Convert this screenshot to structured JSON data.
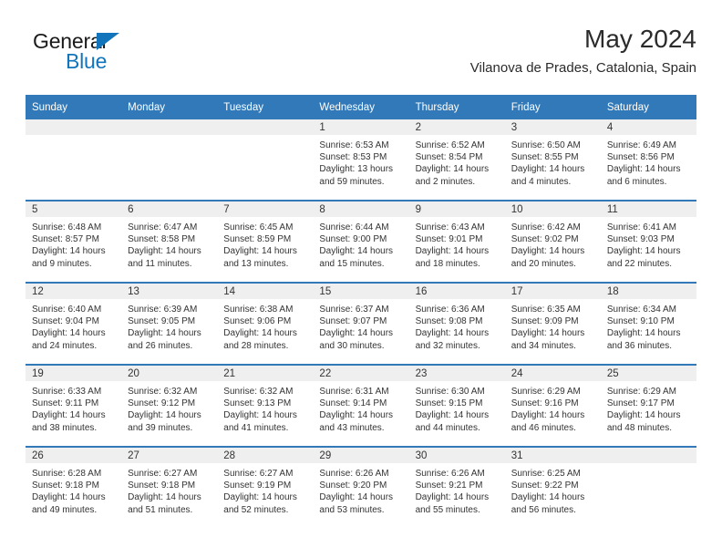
{
  "brand": {
    "name_part1": "General",
    "name_part2": "Blue",
    "triangle_color": "#1275bc"
  },
  "header": {
    "month_title": "May 2024",
    "location": "Vilanova de Prades, Catalonia, Spain"
  },
  "theme": {
    "header_blue": "#3179b8",
    "daynum_band": "#efefef",
    "text": "#333333"
  },
  "calendar": {
    "weekday_headers": [
      "Sunday",
      "Monday",
      "Tuesday",
      "Wednesday",
      "Thursday",
      "Friday",
      "Saturday"
    ],
    "weeks": [
      [
        {
          "day": "",
          "empty": true
        },
        {
          "day": "",
          "empty": true
        },
        {
          "day": "",
          "empty": true
        },
        {
          "day": "1",
          "sunrise": "Sunrise: 6:53 AM",
          "sunset": "Sunset: 8:53 PM",
          "daylight": "Daylight: 13 hours and 59 minutes."
        },
        {
          "day": "2",
          "sunrise": "Sunrise: 6:52 AM",
          "sunset": "Sunset: 8:54 PM",
          "daylight": "Daylight: 14 hours and 2 minutes."
        },
        {
          "day": "3",
          "sunrise": "Sunrise: 6:50 AM",
          "sunset": "Sunset: 8:55 PM",
          "daylight": "Daylight: 14 hours and 4 minutes."
        },
        {
          "day": "4",
          "sunrise": "Sunrise: 6:49 AM",
          "sunset": "Sunset: 8:56 PM",
          "daylight": "Daylight: 14 hours and 6 minutes."
        }
      ],
      [
        {
          "day": "5",
          "sunrise": "Sunrise: 6:48 AM",
          "sunset": "Sunset: 8:57 PM",
          "daylight": "Daylight: 14 hours and 9 minutes."
        },
        {
          "day": "6",
          "sunrise": "Sunrise: 6:47 AM",
          "sunset": "Sunset: 8:58 PM",
          "daylight": "Daylight: 14 hours and 11 minutes."
        },
        {
          "day": "7",
          "sunrise": "Sunrise: 6:45 AM",
          "sunset": "Sunset: 8:59 PM",
          "daylight": "Daylight: 14 hours and 13 minutes."
        },
        {
          "day": "8",
          "sunrise": "Sunrise: 6:44 AM",
          "sunset": "Sunset: 9:00 PM",
          "daylight": "Daylight: 14 hours and 15 minutes."
        },
        {
          "day": "9",
          "sunrise": "Sunrise: 6:43 AM",
          "sunset": "Sunset: 9:01 PM",
          "daylight": "Daylight: 14 hours and 18 minutes."
        },
        {
          "day": "10",
          "sunrise": "Sunrise: 6:42 AM",
          "sunset": "Sunset: 9:02 PM",
          "daylight": "Daylight: 14 hours and 20 minutes."
        },
        {
          "day": "11",
          "sunrise": "Sunrise: 6:41 AM",
          "sunset": "Sunset: 9:03 PM",
          "daylight": "Daylight: 14 hours and 22 minutes."
        }
      ],
      [
        {
          "day": "12",
          "sunrise": "Sunrise: 6:40 AM",
          "sunset": "Sunset: 9:04 PM",
          "daylight": "Daylight: 14 hours and 24 minutes."
        },
        {
          "day": "13",
          "sunrise": "Sunrise: 6:39 AM",
          "sunset": "Sunset: 9:05 PM",
          "daylight": "Daylight: 14 hours and 26 minutes."
        },
        {
          "day": "14",
          "sunrise": "Sunrise: 6:38 AM",
          "sunset": "Sunset: 9:06 PM",
          "daylight": "Daylight: 14 hours and 28 minutes."
        },
        {
          "day": "15",
          "sunrise": "Sunrise: 6:37 AM",
          "sunset": "Sunset: 9:07 PM",
          "daylight": "Daylight: 14 hours and 30 minutes."
        },
        {
          "day": "16",
          "sunrise": "Sunrise: 6:36 AM",
          "sunset": "Sunset: 9:08 PM",
          "daylight": "Daylight: 14 hours and 32 minutes."
        },
        {
          "day": "17",
          "sunrise": "Sunrise: 6:35 AM",
          "sunset": "Sunset: 9:09 PM",
          "daylight": "Daylight: 14 hours and 34 minutes."
        },
        {
          "day": "18",
          "sunrise": "Sunrise: 6:34 AM",
          "sunset": "Sunset: 9:10 PM",
          "daylight": "Daylight: 14 hours and 36 minutes."
        }
      ],
      [
        {
          "day": "19",
          "sunrise": "Sunrise: 6:33 AM",
          "sunset": "Sunset: 9:11 PM",
          "daylight": "Daylight: 14 hours and 38 minutes."
        },
        {
          "day": "20",
          "sunrise": "Sunrise: 6:32 AM",
          "sunset": "Sunset: 9:12 PM",
          "daylight": "Daylight: 14 hours and 39 minutes."
        },
        {
          "day": "21",
          "sunrise": "Sunrise: 6:32 AM",
          "sunset": "Sunset: 9:13 PM",
          "daylight": "Daylight: 14 hours and 41 minutes."
        },
        {
          "day": "22",
          "sunrise": "Sunrise: 6:31 AM",
          "sunset": "Sunset: 9:14 PM",
          "daylight": "Daylight: 14 hours and 43 minutes."
        },
        {
          "day": "23",
          "sunrise": "Sunrise: 6:30 AM",
          "sunset": "Sunset: 9:15 PM",
          "daylight": "Daylight: 14 hours and 44 minutes."
        },
        {
          "day": "24",
          "sunrise": "Sunrise: 6:29 AM",
          "sunset": "Sunset: 9:16 PM",
          "daylight": "Daylight: 14 hours and 46 minutes."
        },
        {
          "day": "25",
          "sunrise": "Sunrise: 6:29 AM",
          "sunset": "Sunset: 9:17 PM",
          "daylight": "Daylight: 14 hours and 48 minutes."
        }
      ],
      [
        {
          "day": "26",
          "sunrise": "Sunrise: 6:28 AM",
          "sunset": "Sunset: 9:18 PM",
          "daylight": "Daylight: 14 hours and 49 minutes."
        },
        {
          "day": "27",
          "sunrise": "Sunrise: 6:27 AM",
          "sunset": "Sunset: 9:18 PM",
          "daylight": "Daylight: 14 hours and 51 minutes."
        },
        {
          "day": "28",
          "sunrise": "Sunrise: 6:27 AM",
          "sunset": "Sunset: 9:19 PM",
          "daylight": "Daylight: 14 hours and 52 minutes."
        },
        {
          "day": "29",
          "sunrise": "Sunrise: 6:26 AM",
          "sunset": "Sunset: 9:20 PM",
          "daylight": "Daylight: 14 hours and 53 minutes."
        },
        {
          "day": "30",
          "sunrise": "Sunrise: 6:26 AM",
          "sunset": "Sunset: 9:21 PM",
          "daylight": "Daylight: 14 hours and 55 minutes."
        },
        {
          "day": "31",
          "sunrise": "Sunrise: 6:25 AM",
          "sunset": "Sunset: 9:22 PM",
          "daylight": "Daylight: 14 hours and 56 minutes."
        },
        {
          "day": "",
          "empty": true
        }
      ]
    ]
  }
}
